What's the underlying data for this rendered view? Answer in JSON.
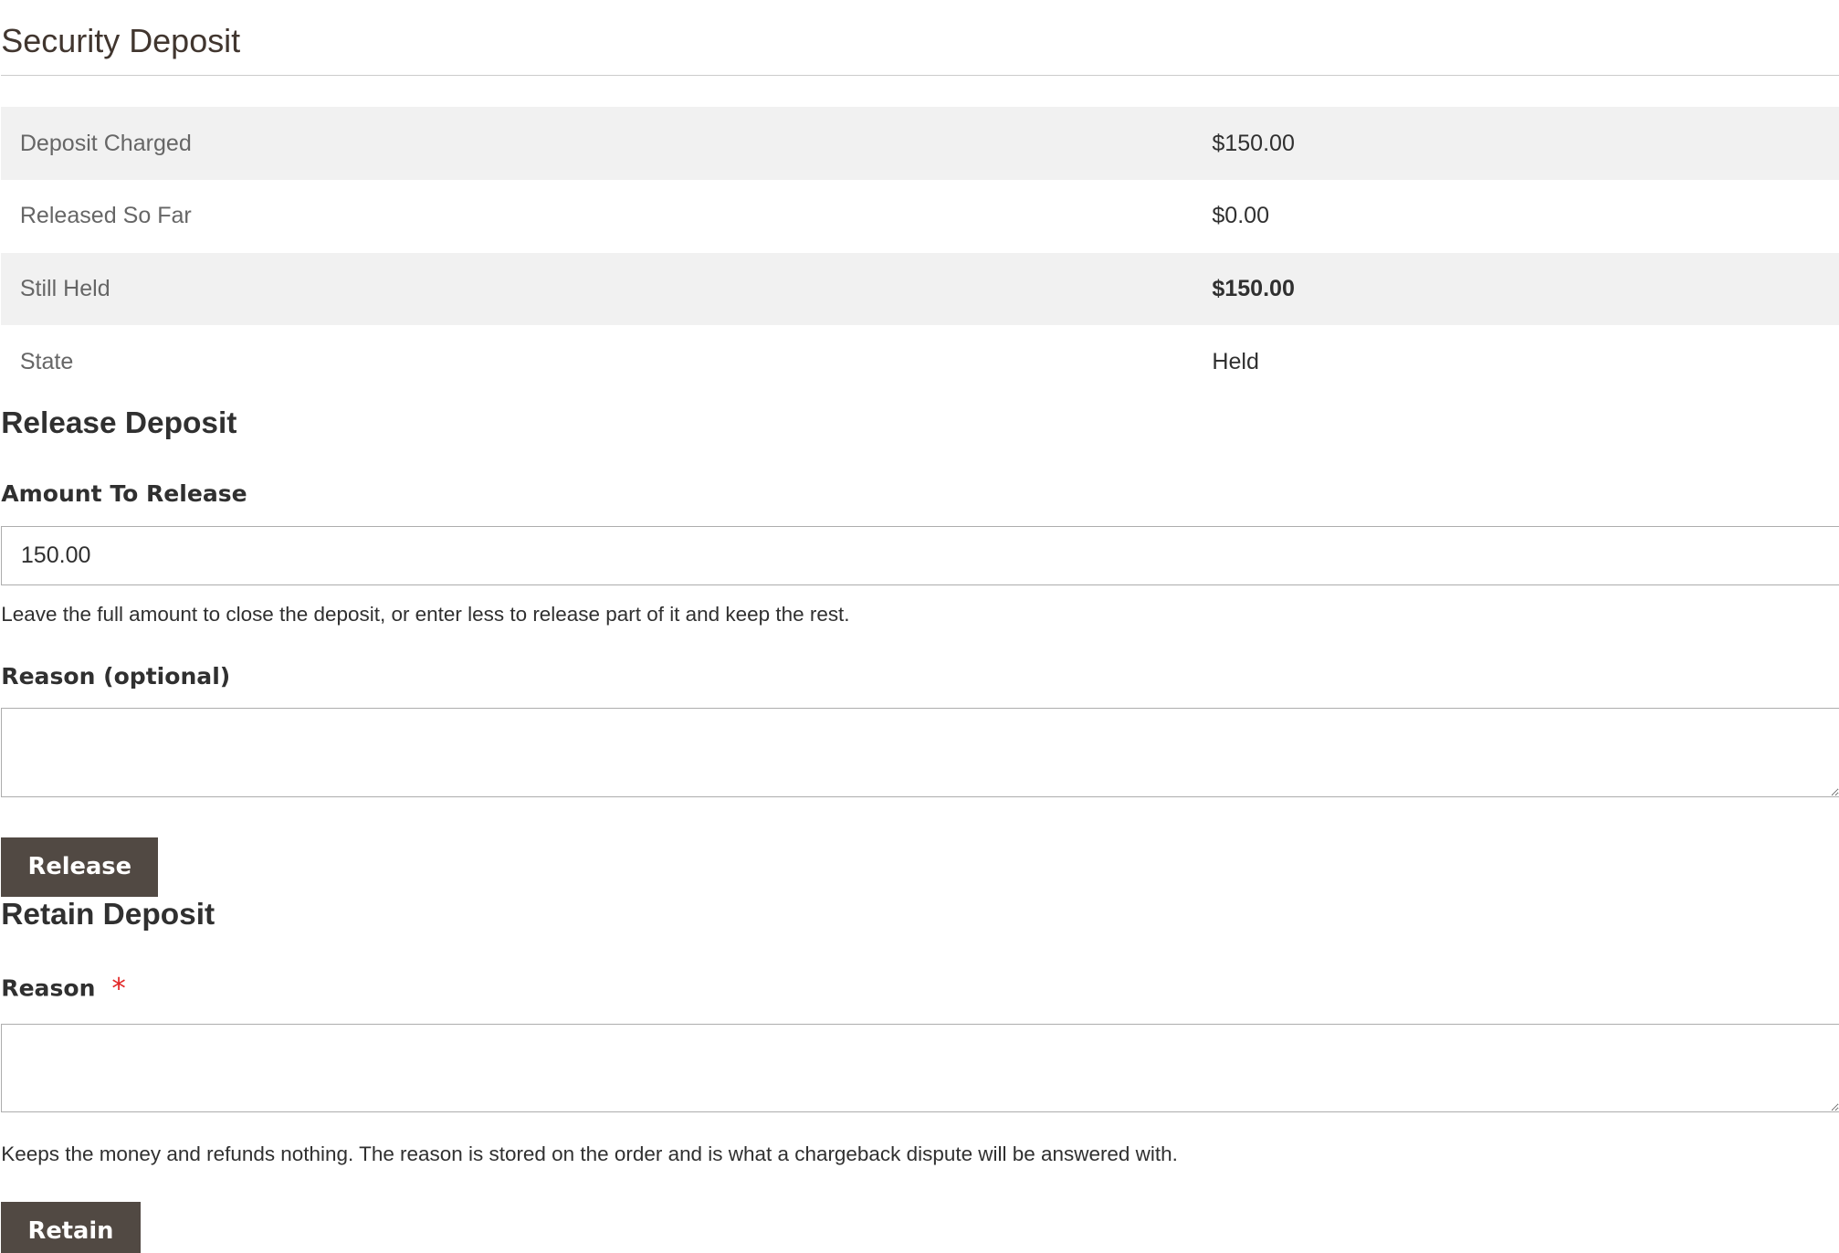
{
  "header": {
    "title": "Security Deposit"
  },
  "summary": {
    "rows": [
      {
        "label": "Deposit Charged",
        "value": "$150.00"
      },
      {
        "label": "Released So Far",
        "value": "$0.00"
      },
      {
        "label": "Still Held",
        "value": "$150.00"
      },
      {
        "label": "State",
        "value": "Held"
      }
    ]
  },
  "release": {
    "title": "Release Deposit",
    "amount_label": "Amount To Release",
    "amount_value": "150.00",
    "amount_note": "Leave the full amount to close the deposit, or enter less to release part of it and keep the rest.",
    "reason_label": "Reason (optional)",
    "reason_value": "",
    "button_label": "Release"
  },
  "retain": {
    "title": "Retain Deposit",
    "reason_label": "Reason",
    "required_marker": "*",
    "reason_value": "",
    "note": "Keeps the money and refunds nothing. The reason is stored on the order and is what a chargeback dispute will be answered with.",
    "button_label": "Retain"
  },
  "colors": {
    "button_bg": "#514943",
    "required": "#e22626",
    "row_stripe": "#f1f1f1"
  }
}
